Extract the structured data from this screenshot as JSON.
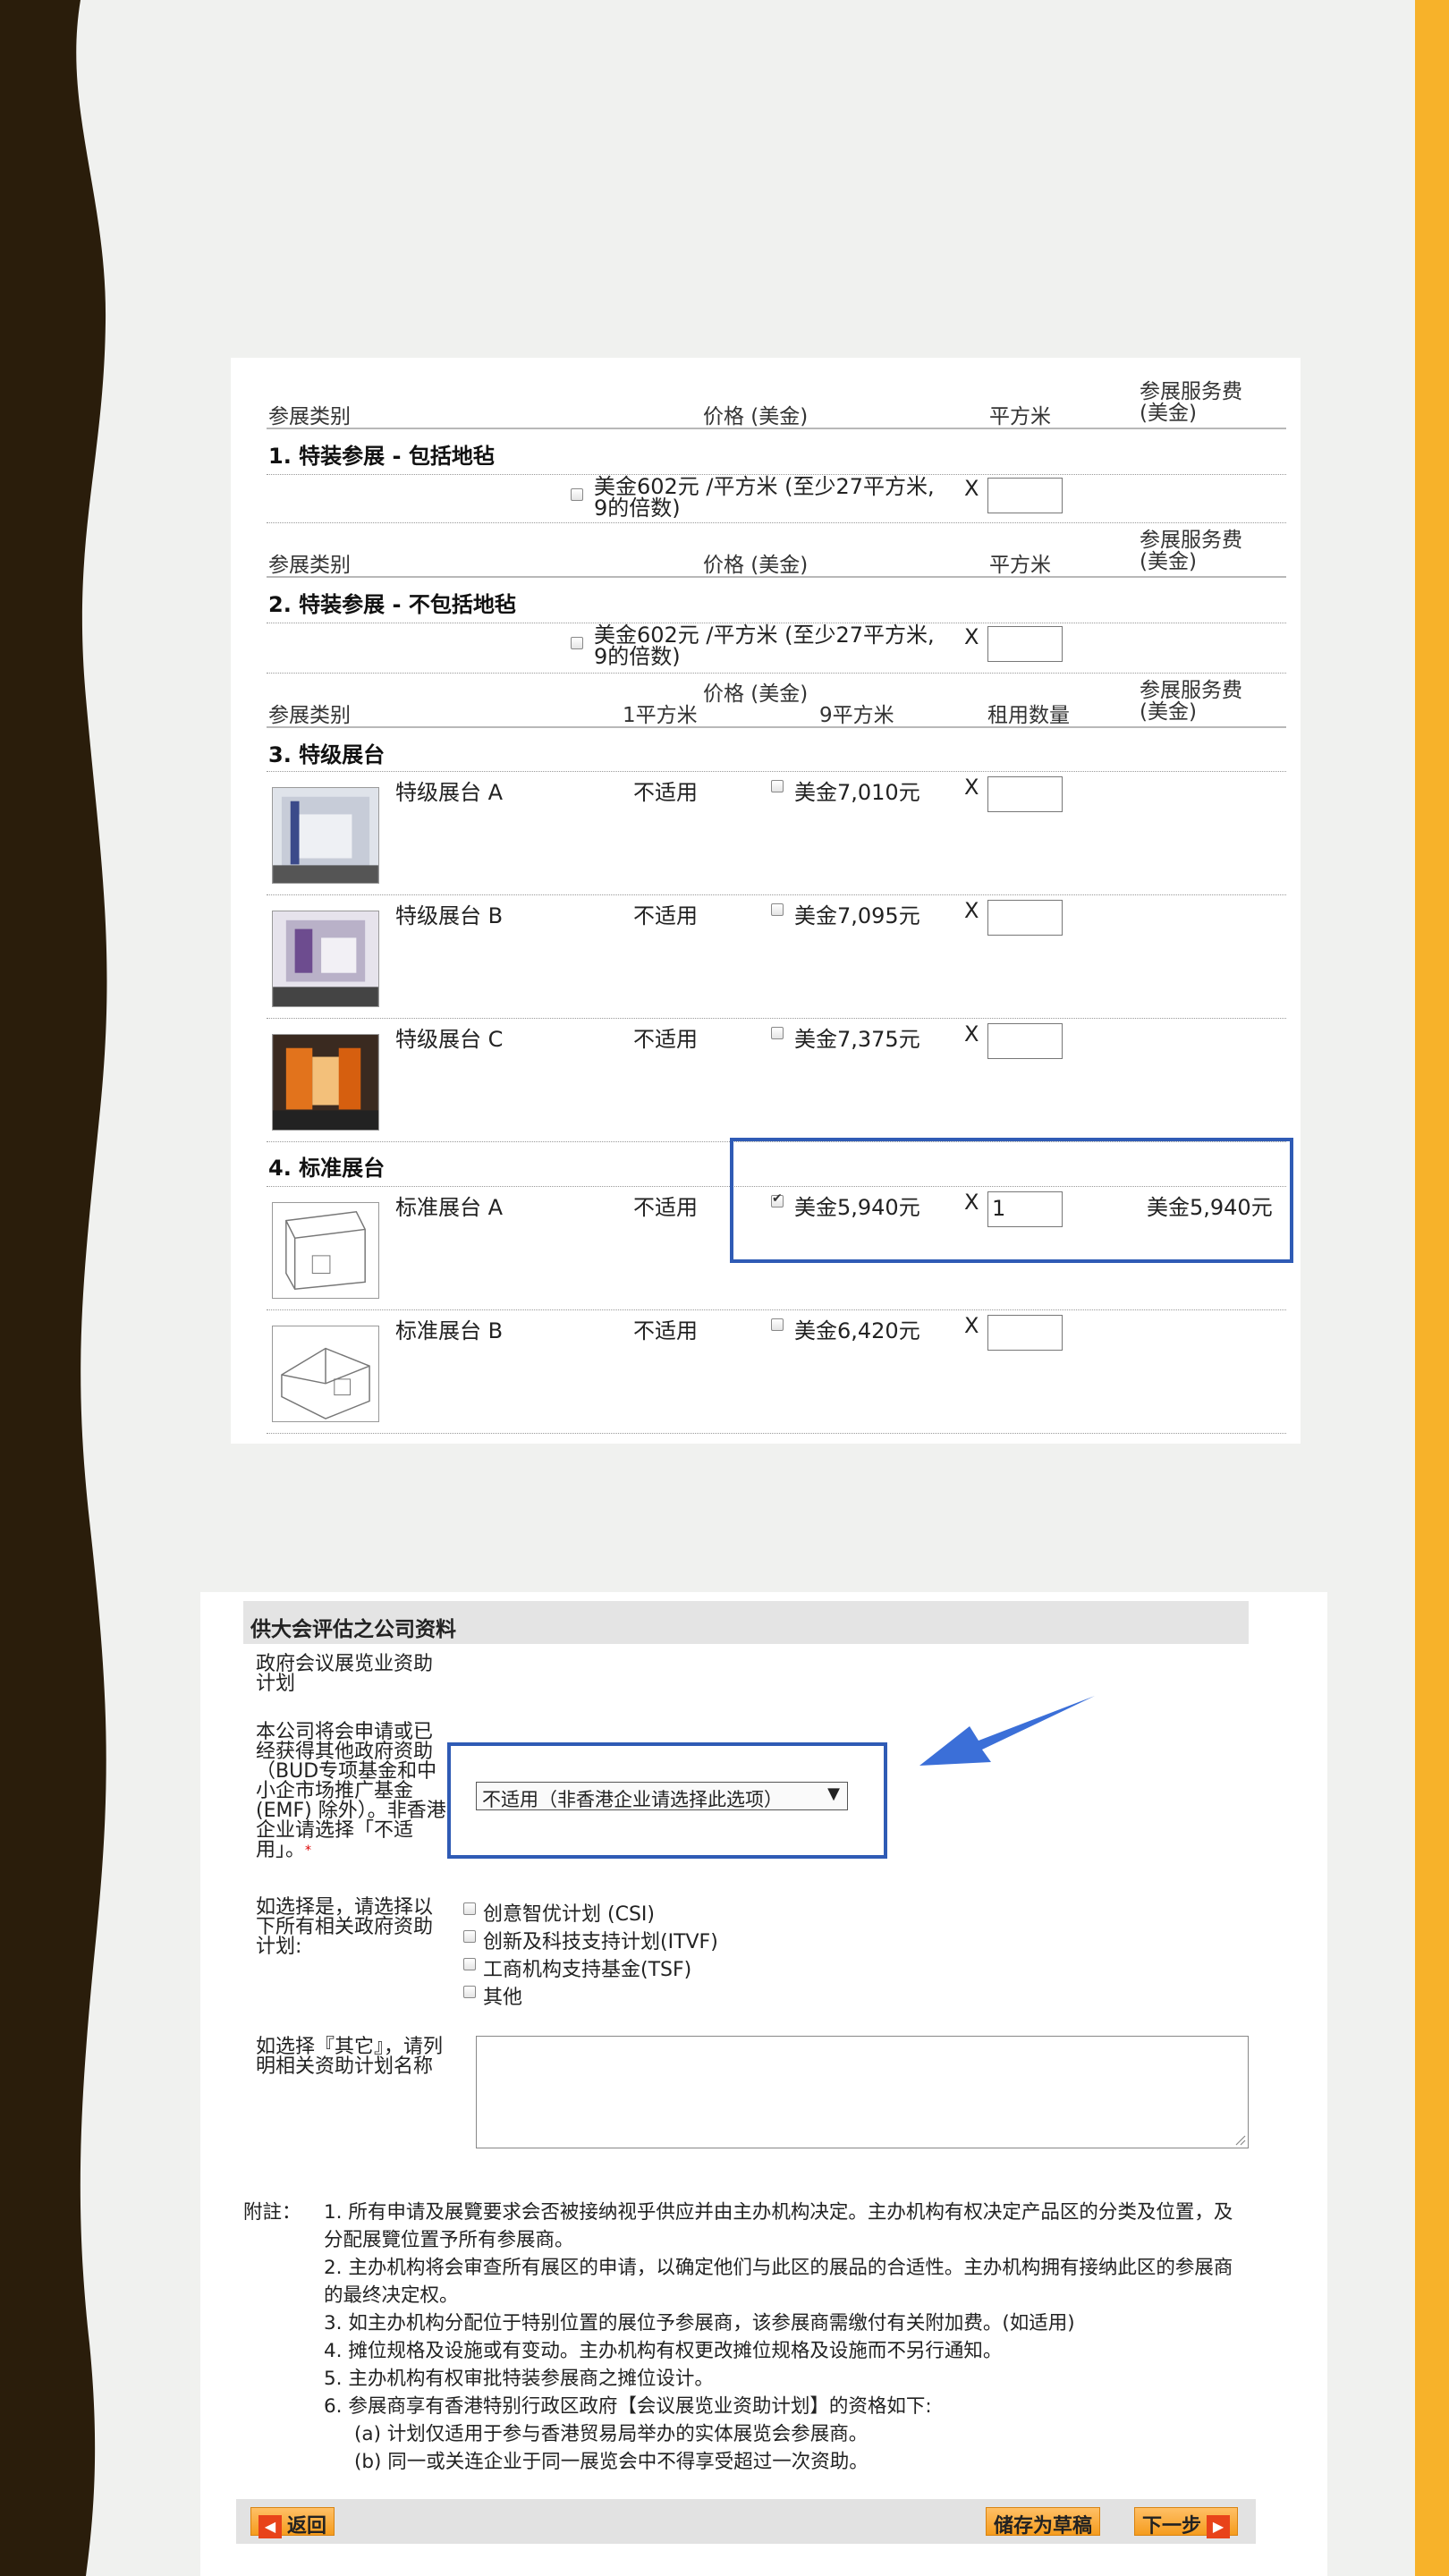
{
  "booth_table": {
    "headers": {
      "category": "参展类别",
      "price": "价格 (美金)",
      "sqm": "平方米",
      "fee_line1": "参展服务费",
      "fee_line2": "(美金)",
      "one_sqm": "1平方米",
      "nine_sqm": "9平方米",
      "rent_qty": "租用数量"
    },
    "sections": [
      {
        "title": "1. 特装参展 - 包括地毡",
        "price_line1": "美金602元 /平方米 (至少27平方米,",
        "price_line2": "9的倍数)"
      },
      {
        "title": "2. 特装参展 - 不包括地毡",
        "price_line1": "美金602元 /平方米 (至少27平方米,",
        "price_line2": "9的倍数)"
      },
      {
        "title": "3. 特级展台"
      },
      {
        "title": "4. 标准展台"
      }
    ],
    "multiply": "X",
    "premium_booths": [
      {
        "name": "特级展台 A",
        "one_sqm": "不适用",
        "nine_sqm": "美金7,010元",
        "checked": false,
        "qty": ""
      },
      {
        "name": "特级展台 B",
        "one_sqm": "不适用",
        "nine_sqm": "美金7,095元",
        "checked": false,
        "qty": ""
      },
      {
        "name": "特级展台 C",
        "one_sqm": "不适用",
        "nine_sqm": "美金7,375元",
        "checked": false,
        "qty": ""
      }
    ],
    "standard_booths": [
      {
        "name": "标准展台 A",
        "one_sqm": "不适用",
        "nine_sqm": "美金5,940元",
        "checked": true,
        "qty": "1",
        "fee": "美金5,940元"
      },
      {
        "name": "标准展台 B",
        "one_sqm": "不适用",
        "nine_sqm": "美金6,420元",
        "checked": false,
        "qty": ""
      }
    ]
  },
  "company_info": {
    "title": "供大会评估之公司资料",
    "gov_scheme_label": "政府会议展览业资助计划",
    "apply_label": "本公司将会申请或已经获得其他政府资助（BUD专项基金和中小企市场推广基金(EMF) 除外）。非香港企业请选择「不适用」。",
    "required_mark": "*",
    "select_value": "不适用（非香港企业请选择此选项）",
    "select_arrow": "▼",
    "if_yes_label": "如选择是，请选择以下所有相关政府资助计划:",
    "options": [
      {
        "label": "创意智优计划 (CSI)",
        "checked": false
      },
      {
        "label": "创新及科技支持计划(ITVF)",
        "checked": false
      },
      {
        "label": "工商机构支持基金(TSF)",
        "checked": false
      },
      {
        "label": "其他",
        "checked": false
      }
    ],
    "other_label": "如选择『其它』，请列明相关资助计划名称",
    "other_value": ""
  },
  "notes": {
    "label": "附註：",
    "items": [
      "1. 所有申请及展覽要求会否被接纳视乎供应并由主办机构决定。主办机构有权决定产品区的分类及位置，及分配展覽位置予所有参展商。",
      "2. 主办机构将会审查所有展区的申请，以确定他们与此区的展品的合适性。主办机构拥有接纳此区的参展商的最终决定权。",
      "3. 如主办机构分配位于特别位置的展位予参展商，该参展商需缴付有关附加费。(如适用)",
      "4. 摊位规格及设施或有变动。主办机构有权更改摊位规格及设施而不另行通知。",
      "5. 主办机构有权审批特装参展商之摊位设计。",
      "6. 参展商享有香港特别行政区政府【会议展览业资助计划】的资格如下:"
    ],
    "sub_items": [
      "(a) 计划仅适用于参与香港贸易局举办的实体展览会参展商。",
      "(b) 同一或关连企业于同一展览会中不得享受超过一次资助。"
    ]
  },
  "buttons": {
    "back": "返回",
    "save_draft": "储存为草稿",
    "next": "下一步"
  },
  "colors": {
    "accent_orange": "#f7b22a",
    "highlight_blue": "#2f5bb5",
    "wave_brown": "#2a1d0b"
  }
}
